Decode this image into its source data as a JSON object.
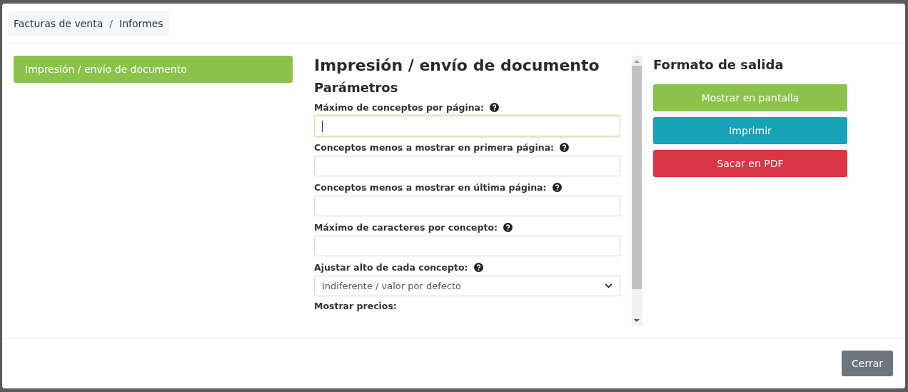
{
  "breadcrumb": {
    "items": [
      "Facturas de venta",
      "Informes"
    ],
    "separator": "/"
  },
  "sidebar": {
    "items": [
      {
        "label": "Impresión / envío de documento",
        "selected": true
      }
    ]
  },
  "form": {
    "title": "Impresión / envío de documento",
    "subtitle": "Parámetros",
    "fields": [
      {
        "kind": "text",
        "label": "Máximo de conceptos por página:",
        "focused": true
      },
      {
        "kind": "text",
        "label": "Conceptos menos a mostrar en primera página:",
        "focused": false
      },
      {
        "kind": "text",
        "label": "Conceptos menos a mostrar en última página:",
        "focused": false
      },
      {
        "kind": "text",
        "label": "Máximo de caracteres por concepto:",
        "focused": false
      },
      {
        "kind": "select",
        "label": "Ajustar alto de cada concepto:",
        "value": "Indiferente / valor por defecto",
        "focused": false
      },
      {
        "kind": "heading",
        "label": "Mostrar precios:"
      }
    ]
  },
  "output": {
    "title": "Formato de salida",
    "buttons": [
      {
        "label": "Mostrar en pantalla",
        "color": "#8bc34a"
      },
      {
        "label": "Imprimir",
        "color": "#17a2b8"
      },
      {
        "label": "Sacar en PDF",
        "color": "#dc3545"
      }
    ]
  },
  "footer": {
    "close": "Cerrar"
  }
}
